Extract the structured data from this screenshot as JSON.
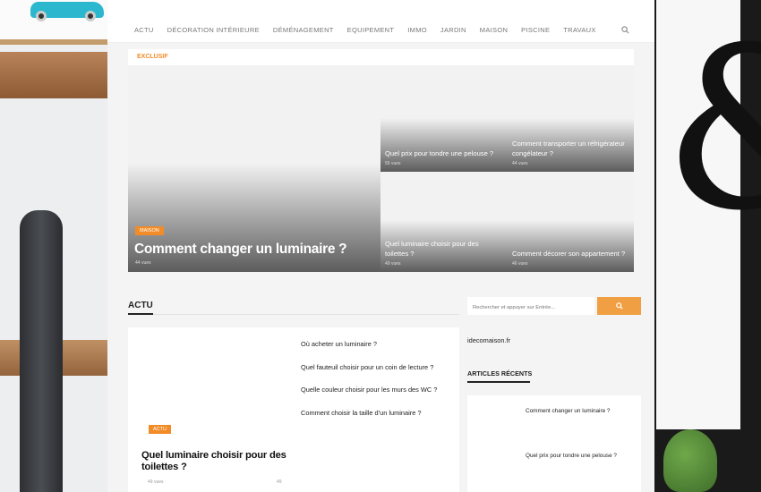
{
  "nav": {
    "items": [
      "ACTU",
      "DÉCORATION INTÉRIEURE",
      "DÉMÉNAGEMENT",
      "EQUIPEMENT",
      "IMMO",
      "JARDIN",
      "MAISON",
      "PISCINE",
      "TRAVAUX"
    ]
  },
  "exclusive_label": "EXCLUSIF",
  "hero": {
    "main": {
      "category": "MAISON",
      "title": "Comment changer un luminaire ?",
      "views": "44 vues"
    },
    "tiles": [
      {
        "title": "Quel prix pour tondre une pelouse ?",
        "views": "55 vues"
      },
      {
        "title": "Comment transporter un réfrigérateur congélateur ?",
        "views": "44 vues"
      },
      {
        "title": "Quel luminaire choisir pour des toilettes ?",
        "views": "49 vues"
      },
      {
        "title": "Comment décorer son appartement ?",
        "views": "46 vues"
      }
    ]
  },
  "section": {
    "title": "ACTU"
  },
  "featured": {
    "category": "ACTU",
    "title": "Quel luminaire choisir pour des toilettes ?",
    "views": "49 vues",
    "comments": "49"
  },
  "list": [
    "Où acheter un luminaire ?",
    "Quel fauteuil choisir pour un coin de lecture ?",
    "Quelle couleur choisir pour les murs des WC ?",
    "Comment choisir la taille d'un luminaire ?"
  ],
  "sidebar": {
    "search_placeholder": "Rechercher et appuyer sur Entrée...",
    "site_name": "idecomaison.fr",
    "recent_title": "ARTICLES RÉCENTS",
    "recent": [
      "Comment changer un luminaire ?",
      "Quel prix pour tondre une pelouse ?"
    ]
  },
  "colors": {
    "accent": "#f28c28",
    "search_button": "#f0a042"
  }
}
